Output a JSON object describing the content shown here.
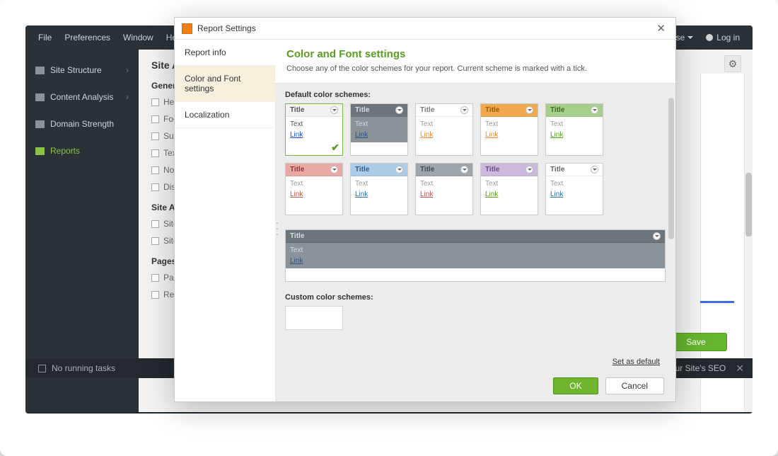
{
  "menubar": {
    "items": [
      "File",
      "Preferences",
      "Window",
      "Help"
    ]
  },
  "topright": {
    "close": "Close",
    "login": "Log in"
  },
  "sidebar": {
    "items": [
      {
        "label": "Site Structure",
        "expandable": true
      },
      {
        "label": "Content Analysis",
        "expandable": true
      },
      {
        "label": "Domain Strength",
        "expandable": false
      },
      {
        "label": "Reports",
        "expandable": false,
        "active": true
      }
    ]
  },
  "main_panel": {
    "heading": "Site Au",
    "section_general": "Genera",
    "general_items": [
      "Head",
      "Foote",
      "Sumn",
      "Text",
      "Note",
      "Distri"
    ],
    "section_site": "Site Au",
    "site_items": [
      "Site A",
      "Site A"
    ],
    "section_pages": "Pages &",
    "pages_items": [
      "Page:",
      "Reso"
    ]
  },
  "footer": {
    "tasks_label": "No running tasks",
    "seo_toast": "our Site's SEO"
  },
  "save_button": "Save",
  "dialog": {
    "title": "Report Settings",
    "tabs": [
      "Report info",
      "Color and Font settings",
      "Localization"
    ],
    "active_tab": 1,
    "heading": "Color and Font settings",
    "subtitle": "Choose any of the color schemes for your report. Current scheme is marked with a tick.",
    "default_label": "Default color schemes:",
    "custom_label": "Custom color schemes:",
    "set_default": "Set as default",
    "ok": "OK",
    "cancel": "Cancel",
    "swatch_title": "Title",
    "swatch_text": "Text",
    "swatch_link": "Link",
    "schemes": [
      {
        "title_bg": "#f3f3f3",
        "title_fg": "#555555",
        "body_bg": "#ffffff",
        "text": "#555555",
        "link": "#1a4fd6",
        "selected": true
      },
      {
        "title_bg": "#6b757b",
        "title_fg": "#d8dcde",
        "body_bg": "#8a9399",
        "text": "#d8dcde",
        "link": "#2e527c"
      },
      {
        "title_bg": "#ffffff",
        "title_fg": "#777777",
        "body_bg": "#ffffff",
        "text": "#999999",
        "link": "#e88b3a"
      },
      {
        "title_bg": "#f0a94e",
        "title_fg": "#9a5a00",
        "body_bg": "#ffffff",
        "text": "#999999",
        "link": "#e88b3a"
      },
      {
        "title_bg": "#a6cf8b",
        "title_fg": "#3a6e1c",
        "body_bg": "#ffffff",
        "text": "#999999",
        "link": "#5a9e20"
      },
      {
        "title_bg": "#e9a9a4",
        "title_fg": "#8e3a33",
        "body_bg": "#ffffff",
        "text": "#999999",
        "link": "#c85a50"
      },
      {
        "title_bg": "#aecbe8",
        "title_fg": "#2d5f94",
        "body_bg": "#ffffff",
        "text": "#999999",
        "link": "#2a6fb0"
      },
      {
        "title_bg": "#9ea5ab",
        "title_fg": "#444a4e",
        "body_bg": "#ffffff",
        "text": "#999999",
        "link": "#c85a50"
      },
      {
        "title_bg": "#cdb9dc",
        "title_fg": "#6b4e86",
        "body_bg": "#ffffff",
        "text": "#999999",
        "link": "#5a9e20"
      },
      {
        "title_bg": "#ffffff",
        "title_fg": "#666666",
        "body_bg": "#ffffff",
        "text": "#999999",
        "link": "#2a6fb0"
      },
      {
        "title_bg": "#6b757b",
        "title_fg": "#d8dcde",
        "body_bg": "#8a9399",
        "text": "#d8dcde",
        "link": "#2e527c",
        "tall": true
      }
    ]
  }
}
